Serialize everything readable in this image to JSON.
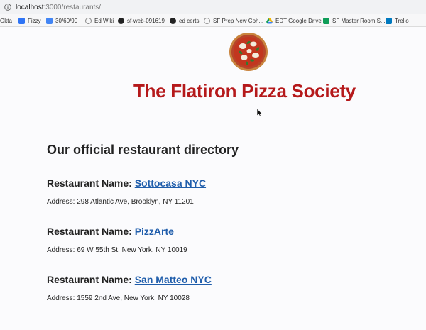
{
  "browser": {
    "url_host": "localhost",
    "url_path": ":3000/restaurants/",
    "bookmarks": [
      {
        "label": "Okta",
        "icon": "okta-icon",
        "color": ""
      },
      {
        "label": "Fizzy",
        "icon": "fizzy-icon",
        "color": "#2f74f5"
      },
      {
        "label": "30/60/90",
        "icon": "google-docs-icon",
        "color": "#4285f4"
      },
      {
        "label": "Ed Wiki",
        "icon": "globe-icon",
        "color": "#888888"
      },
      {
        "label": "sf-web-091619",
        "icon": "github-icon",
        "color": "#222222"
      },
      {
        "label": "ed certs",
        "icon": "github-icon",
        "color": "#222222"
      },
      {
        "label": "SF Prep New Coh...",
        "icon": "globe-icon",
        "color": "#888888"
      },
      {
        "label": "EDT Google Drive",
        "icon": "google-drive-icon",
        "color": "#f4b400"
      },
      {
        "label": "SF Master Room S...",
        "icon": "google-sheets-icon",
        "color": "#0f9d58"
      },
      {
        "label": "Trello",
        "icon": "trello-icon",
        "color": "#0079bf"
      }
    ]
  },
  "page": {
    "title": "The Flatiron Pizza Society",
    "directory_heading": "Our official restaurant directory",
    "name_prefix": "Restaurant Name: ",
    "restaurants": [
      {
        "name": "Sottocasa NYC",
        "address": "Address: 298 Atlantic Ave, Brooklyn, NY 11201"
      },
      {
        "name": "PizzArte",
        "address": "Address: 69 W 55th St, New York, NY 10019"
      },
      {
        "name": "San Matteo NYC",
        "address": "Address: 1559 2nd Ave, New York, NY 10028"
      }
    ]
  },
  "colors": {
    "title": "#b5191b",
    "link": "#1f5dab"
  }
}
